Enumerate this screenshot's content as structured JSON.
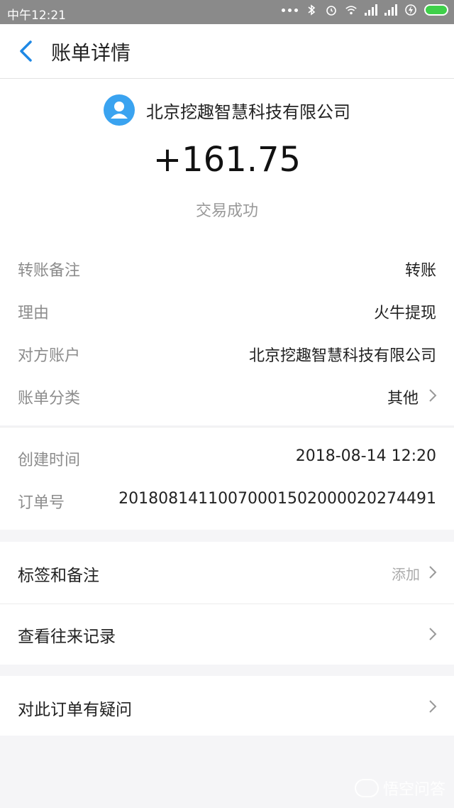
{
  "status_bar": {
    "time": "中午12:21",
    "icons": [
      "more-dots-icon",
      "bluetooth-icon",
      "alarm-icon",
      "wifi-icon",
      "signal-icon",
      "signal-icon",
      "charging-icon",
      "battery-icon"
    ]
  },
  "nav": {
    "title": "账单详情",
    "back_icon": "chevron-left-icon"
  },
  "header": {
    "payee": "北京挖趣智慧科技有限公司",
    "amount": "+161.75",
    "status": "交易成功"
  },
  "details": [
    {
      "label": "转账备注",
      "value": "转账"
    },
    {
      "label": "理由",
      "value": "火牛提现"
    },
    {
      "label": "对方账户",
      "value": "北京挖趣智慧科技有限公司"
    },
    {
      "label": "账单分类",
      "value": "其他"
    }
  ],
  "meta": [
    {
      "label": "创建时间",
      "value": "2018-08-14 12:20"
    },
    {
      "label": "订单号",
      "value": "20180814110070001502000020274491"
    }
  ],
  "actions": {
    "tags": {
      "label": "标签和备注",
      "hint": "添加"
    },
    "history": {
      "label": "查看往来记录"
    },
    "question": {
      "label": "对此订单有疑问"
    }
  },
  "watermark": {
    "text": "悟空问答"
  },
  "colors": {
    "accent": "#1e88e5",
    "avatar": "#3aa3f0",
    "battery": "#3fd04a"
  }
}
